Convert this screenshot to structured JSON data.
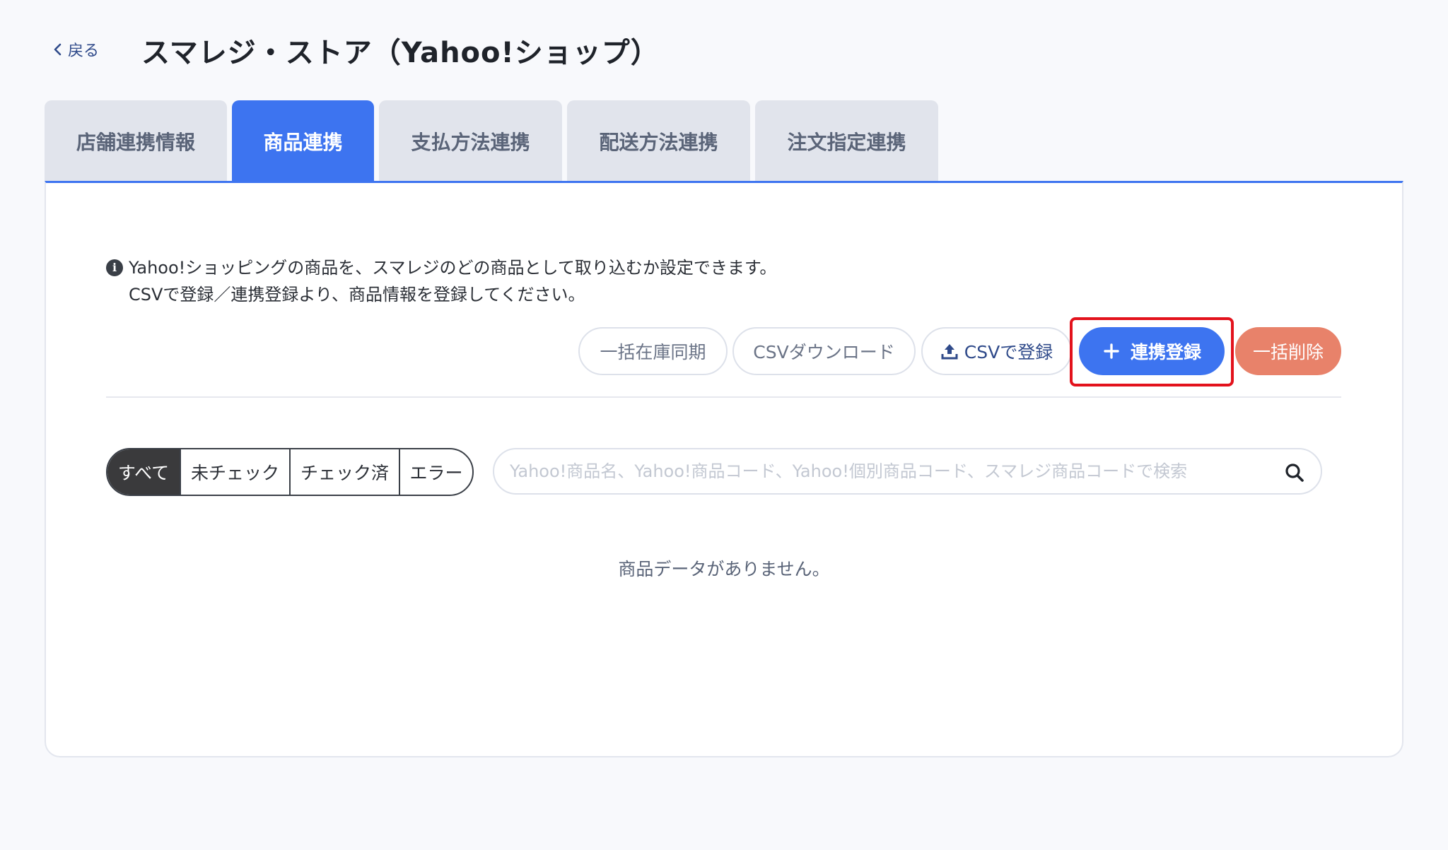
{
  "header": {
    "back_label": "戻る",
    "title": "スマレジ・ストア（Yahoo!ショップ）"
  },
  "tabs": [
    {
      "label": "店舗連携情報",
      "active": false
    },
    {
      "label": "商品連携",
      "active": true
    },
    {
      "label": "支払方法連携",
      "active": false
    },
    {
      "label": "配送方法連携",
      "active": false
    },
    {
      "label": "注文指定連携",
      "active": false
    }
  ],
  "info": {
    "line1": "Yahoo!ショッピングの商品を、スマレジのどの商品として取り込むか設定できます。",
    "line2": "CSVで登録／連携登録より、商品情報を登録してください。"
  },
  "actions": {
    "bulk_stock_sync": "一括在庫同期",
    "csv_download": "CSVダウンロード",
    "csv_register": "CSVで登録",
    "link_register": "連携登録",
    "bulk_delete": "一括削除"
  },
  "filters": [
    {
      "label": "すべて",
      "active": true
    },
    {
      "label": "未チェック",
      "active": false
    },
    {
      "label": "チェック済",
      "active": false
    },
    {
      "label": "エラー",
      "active": false
    }
  ],
  "search": {
    "placeholder": "Yahoo!商品名、Yahoo!商品コード、Yahoo!個別商品コード、スマレジ商品コードで検索",
    "value": ""
  },
  "empty_message": "商品データがありません。",
  "colors": {
    "primary": "#3d74f0",
    "danger": "#e8826a",
    "highlight": "#e3121c"
  }
}
